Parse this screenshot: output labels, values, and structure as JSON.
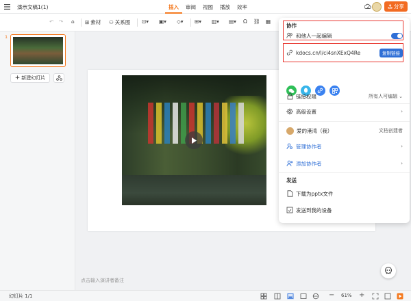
{
  "titlebar": {
    "doc_title": "演示文稿1(1)",
    "tabs": [
      {
        "label": "插入",
        "active": true
      },
      {
        "label": "审阅",
        "active": false
      },
      {
        "label": "视图",
        "active": false
      },
      {
        "label": "播放",
        "active": false
      },
      {
        "label": "效率",
        "active": false
      }
    ],
    "share_label": "分享"
  },
  "toolbar": {
    "material_label": "素材",
    "relation_label": "关系图"
  },
  "slides_panel": {
    "slide_number": "1",
    "new_slide_label": "新建幻灯片"
  },
  "notes_placeholder": "点击输入演讲者备注",
  "status": {
    "slide_counter": "幻灯片 1/1",
    "zoom": "61%"
  },
  "collab_panel": {
    "title": "协作",
    "collab_label": "和他人一起编辑",
    "collab_enabled": true,
    "link_url": "kdocs.cn/l/ci4snXExQ4Re",
    "copy_link_label": "复制链接",
    "permission_label": "链接权限",
    "permission_value": "所有人可编辑",
    "advanced_label": "高级设置",
    "owner_name": "爱的港湾（我）",
    "owner_role": "文档创建者",
    "manage_label": "管理协作者",
    "add_label": "添加协作者",
    "send_title": "发送",
    "download_label": "下载为pptx文件",
    "send_device_label": "发送到我的设备"
  },
  "colors": {
    "accent": "#f47a20",
    "share_button": "#f26b22",
    "link_blue": "#2f6fd6",
    "highlight_red": "#e8322a"
  }
}
